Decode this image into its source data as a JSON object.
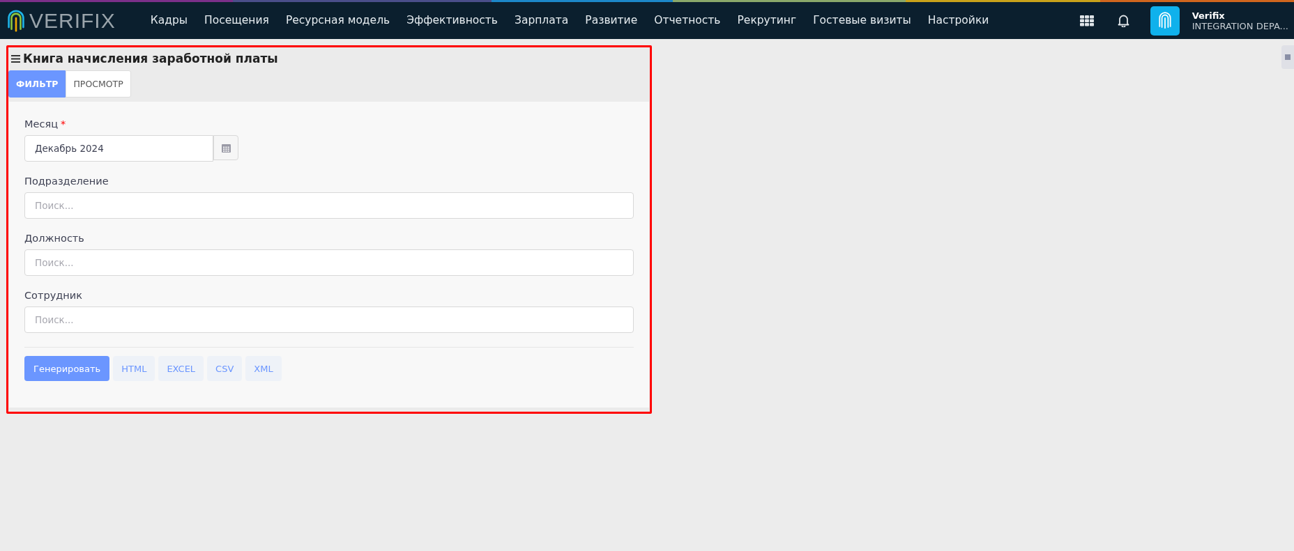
{
  "header": {
    "logo_text": "VERIFIX",
    "nav": [
      {
        "label": "Кадры",
        "selected": false
      },
      {
        "label": "Посещения",
        "selected": false
      },
      {
        "label": "Ресурсная модель",
        "selected": false
      },
      {
        "label": "Эффективность",
        "selected": false
      },
      {
        "label": "Зарплата",
        "selected": false
      },
      {
        "label": "Развитие",
        "selected": false
      },
      {
        "label": "Отчетность",
        "selected": false
      },
      {
        "label": "Рекрутинг",
        "selected": false
      },
      {
        "label": "Гостевые визиты",
        "selected": false
      },
      {
        "label": "Настройки",
        "selected": false
      }
    ],
    "user": {
      "name": "Verifix",
      "org": "INTEGRATION DEPA..."
    }
  },
  "page": {
    "title": "Книга начисления заработной платы",
    "tabs": [
      {
        "label": "ФИЛЬТР",
        "selected": true
      },
      {
        "label": "ПРОСМОТР",
        "selected": false
      }
    ],
    "fields": [
      {
        "kind": "date",
        "label": "Месяц",
        "required_mark": "*",
        "value": "Декабрь 2024"
      },
      {
        "kind": "search",
        "label": "Подразделение",
        "placeholder": "Поиск..."
      },
      {
        "kind": "search",
        "label": "Должность",
        "placeholder": "Поиск..."
      },
      {
        "kind": "search",
        "label": "Сотрудник",
        "placeholder": "Поиск..."
      }
    ],
    "buttons": [
      {
        "label": "Генерировать",
        "primary": true
      },
      {
        "label": "HTML",
        "primary": false
      },
      {
        "label": "EXCEL",
        "primary": false
      },
      {
        "label": "CSV",
        "primary": false
      },
      {
        "label": "XML",
        "primary": false
      }
    ]
  }
}
